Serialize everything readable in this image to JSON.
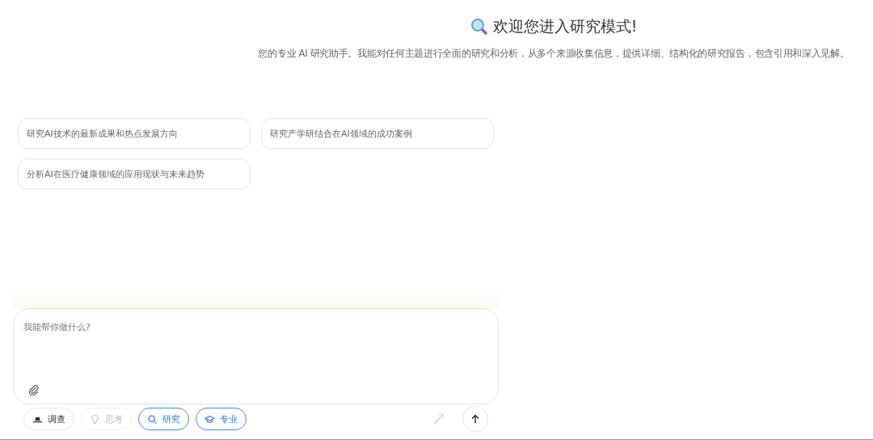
{
  "header": {
    "title": "欢迎您进入研究模式!",
    "subtitle": "您的专业 AI 研究助手。我能对任何主题进行全面的研究和分析，从多个来源收集信息，提供详细、结构化的研究报告，包含引用和深入见解。"
  },
  "suggestions": [
    "研究AI技术的最新成果和热点发展方向",
    "研究产学研结合在AI领域的成功案例",
    "分析AI在医疗健康领域的应用现状与未来趋势"
  ],
  "composer": {
    "placeholder": "我能帮你做什么?"
  },
  "modes": [
    {
      "kind": "hat",
      "label": "调查",
      "selected": false,
      "disabled": false
    },
    {
      "kind": "bulb",
      "label": "思考",
      "selected": false,
      "disabled": true
    },
    {
      "kind": "search",
      "label": "研究",
      "selected": true,
      "disabled": false
    },
    {
      "kind": "cap",
      "label": "专业",
      "selected": true,
      "disabled": false
    }
  ]
}
